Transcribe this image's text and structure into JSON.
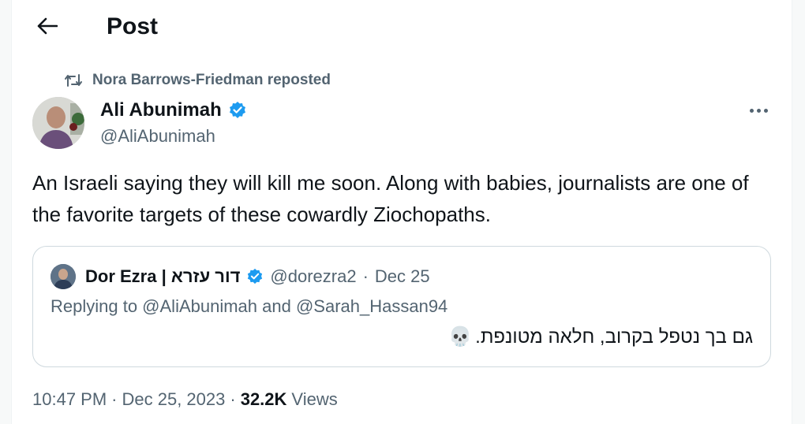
{
  "header": {
    "title": "Post"
  },
  "repost": {
    "text": "Nora Barrows-Friedman reposted"
  },
  "author": {
    "name": "Ali Abunimah",
    "handle": "@AliAbunimah"
  },
  "tweet": {
    "text": "An Israeli saying they will kill me soon. Along with babies, journalists are one of the favorite targets of these cowardly Ziochopaths."
  },
  "quote": {
    "name": "Dor Ezra | דור עזרא",
    "handle": "@dorezra2",
    "separator": "·",
    "date": "Dec 25",
    "replying": "Replying to @AliAbunimah and @Sarah_Hassan94",
    "text": "גם בך נטפל בקרוב, חלאה מטונפת.",
    "emoji": "💀"
  },
  "meta": {
    "time": "10:47 PM",
    "separator1": "·",
    "date": "Dec 25, 2023",
    "separator2": "·",
    "views_count": "32.2K",
    "views_label": "Views"
  },
  "icons": {
    "back": "arrow-left-icon",
    "repost": "repost-icon",
    "verified": "verified-badge-icon",
    "more": "more-horizontal-icon"
  },
  "colors": {
    "verified": "#1d9bf0",
    "secondary_text": "#536471",
    "primary_text": "#0f1419",
    "border": "#cfd9de"
  }
}
